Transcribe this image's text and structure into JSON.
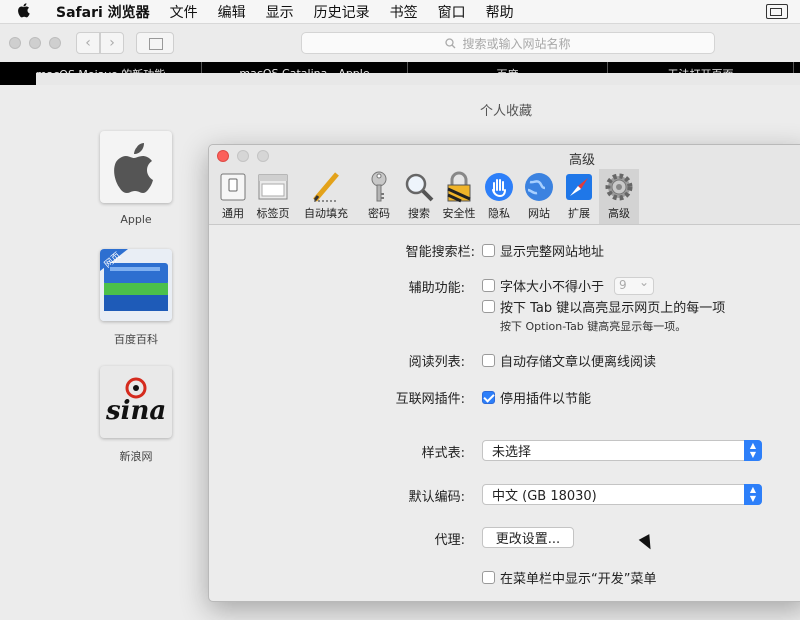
{
  "menubar": {
    "apple_icon": "apple-logo-icon",
    "app_name": "Safari 浏览器",
    "items": [
      "文件",
      "编辑",
      "显示",
      "历史记录",
      "书签",
      "窗口",
      "帮助"
    ]
  },
  "toolbar": {
    "back": "‹",
    "forward": "›",
    "address_placeholder": "搜索或输入网站名称"
  },
  "tabs": [
    {
      "label": "macOS Mojave 的新功能"
    },
    {
      "label": "macOS Catalina - Apple"
    },
    {
      "label": "百度"
    },
    {
      "label": "无法打开页面"
    }
  ],
  "favorites": {
    "title": "个人收藏",
    "items": [
      {
        "label": "Apple"
      },
      {
        "label": "百度百科"
      },
      {
        "label": "新浪网"
      }
    ],
    "baidu_badge": "网页",
    "sina_logo": "sina"
  },
  "prefs": {
    "window_title": "高级",
    "tabs": [
      {
        "label": "通用"
      },
      {
        "label": "标签页"
      },
      {
        "label": "自动填充"
      },
      {
        "label": "密码"
      },
      {
        "label": "搜索"
      },
      {
        "label": "安全性"
      },
      {
        "label": "隐私"
      },
      {
        "label": "网站"
      },
      {
        "label": "扩展"
      },
      {
        "label": "高级"
      }
    ],
    "selected_tab": "高级",
    "smart_search": {
      "label": "智能搜索栏:",
      "option": "显示完整网站地址",
      "checked": false
    },
    "accessibility": {
      "label": "辅助功能:",
      "min_font_option": "字体大小不得小于",
      "min_font_value": "9",
      "tab_option": "按下 Tab 键以高亮显示网页上的每一项",
      "tab_hint": "按下 Option-Tab 键高亮显示每一项。"
    },
    "reading_list": {
      "label": "阅读列表:",
      "option": "自动存储文章以便离线阅读",
      "checked": false
    },
    "plugins": {
      "label": "互联网插件:",
      "option": "停用插件以节能",
      "checked": true
    },
    "stylesheet": {
      "label": "样式表:",
      "value": "未选择"
    },
    "encoding": {
      "label": "默认编码:",
      "value": "中文 (GB 18030)"
    },
    "proxy": {
      "label": "代理:",
      "button": "更改设置..."
    },
    "develop_menu": {
      "option": "在菜单栏中显示“开发”菜单",
      "checked": false
    }
  },
  "colors": {
    "accent": "#2d7ff9",
    "close": "#fc605b",
    "window_bg": "#ececec"
  }
}
